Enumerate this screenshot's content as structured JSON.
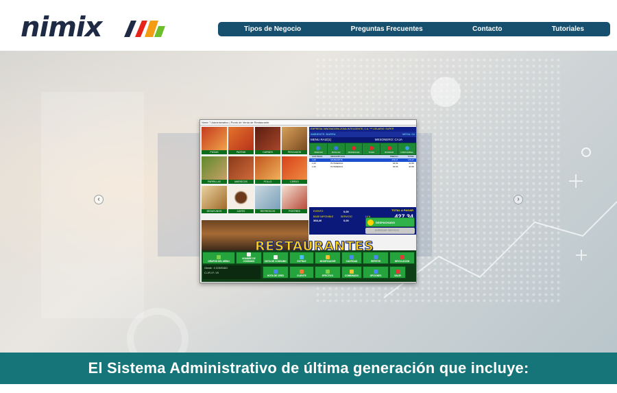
{
  "header": {
    "logo_text": "nimix",
    "nav": [
      {
        "label": "Tipos de Negocio"
      },
      {
        "label": "Preguntas Frecuentes"
      },
      {
        "label": "Contacto"
      },
      {
        "label": "Tutoriales"
      }
    ]
  },
  "colors": {
    "nav_bg": "#17506e",
    "banner_bg": "#167578",
    "accent_yellow": "#ffd21a",
    "pos_green": "#25a33c",
    "pos_blue": "#12218a"
  },
  "slider": {
    "prev_icon": "arrow-left-icon",
    "next_icon": "arrow-right-icon"
  },
  "screenshot": {
    "window_title": "Nimix 7 Administrativo | Punto de Venta de Restaurante",
    "overlay_title": "RESTAURANTES",
    "food_tiles": [
      {
        "label": "PIZZAS"
      },
      {
        "label": "PASTAS"
      },
      {
        "label": "CARNES"
      },
      {
        "label": "PESCADOS"
      },
      {
        "label": "PARRILLAS"
      },
      {
        "label": "MARISCOS"
      },
      {
        "label": "POLLO"
      },
      {
        "label": "CERDO"
      },
      {
        "label": "DESAYUNOS"
      },
      {
        "label": "CAFES"
      },
      {
        "label": "REFRESCOS"
      },
      {
        "label": "POSTRES"
      }
    ],
    "info_line": "EMPRESA: INNOVADORA ZONA INTELIGENTE, C.A. *** USUARIO: SUPER",
    "ambiente": "AMBIENTE: BARRA",
    "mesa": "MESA: 04",
    "menu": "MENU RAIZ(1)",
    "mesonero": "MESONERO: CAJA",
    "action_buttons": [
      "OPERAR",
      "BUSCAR",
      "MODIFICAR",
      "TODO",
      "BORRAR",
      "DISPONIBLE"
    ],
    "table_headers": [
      "CANTIDAD",
      "DESCRIPCION",
      "PRECIO",
      "TOTAL"
    ],
    "table_rows": [
      {
        "qty": "1,00",
        "desc": "MARGARITA",
        "price": "179,17",
        "total": "179,17"
      },
      {
        "qty": "1,00",
        "desc": "PUTANESCA",
        "price": "94,59",
        "total": "94,59"
      },
      {
        "qty": "1,00",
        "desc": "PUTANESCA",
        "price": "94,59",
        "total": "94,59"
      }
    ],
    "total_label": "TOTAL A PAGAR",
    "total_value": "427,34",
    "exento_label": "EXENTO",
    "exento_value": "0,00",
    "base_label": "BASE IMPONIBLE",
    "base_value": "368,40",
    "servicio_label": "SERVICIO",
    "servicio_value": "0,00",
    "iva_label": "I.V.A.",
    "iva_value": "58,94",
    "despachado": "DESPACHADO",
    "agregar": "AGREGAR SERVICIO",
    "bottom_buttons": [
      "GRUPOS DEL MENU",
      "NOMBRE DE CONSUMO",
      "NOTA DE CONSUMO",
      "EXTRAS",
      "MODIFICADOR",
      "CANTIDAD",
      "REPETIR",
      "DEVOLUCION",
      "NOTA DE CRED",
      "CLIENTE",
      "EFECTIVO",
      "COMBINADO",
      "OPCIONES",
      "SALIR"
    ],
    "client_line1": "Cliente : 0 CONTADO",
    "client_line2": "C.I./R.I.F.: V0"
  },
  "banner": {
    "text": "El Sistema Administrativo de última generación que incluye:"
  }
}
